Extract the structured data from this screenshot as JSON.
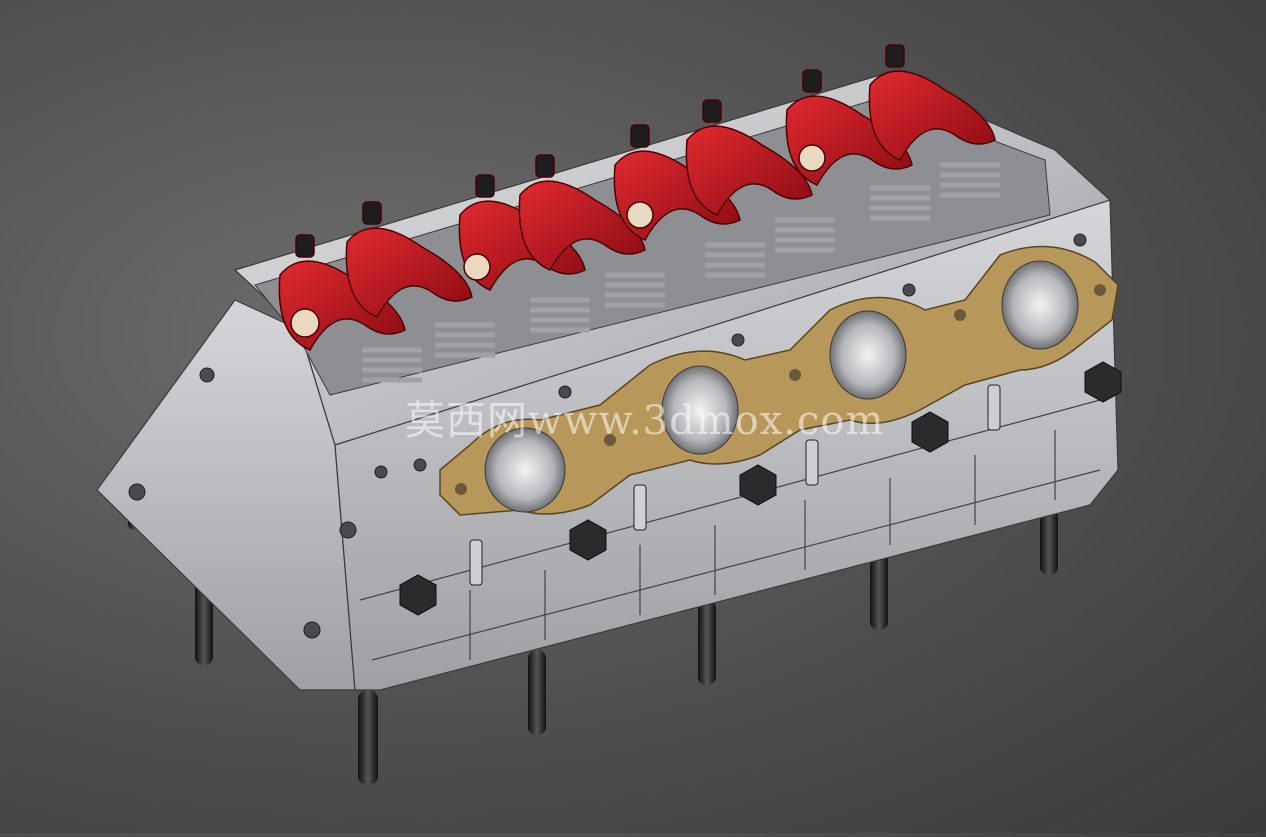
{
  "scene": {
    "subject": "cylinder-head-assembly",
    "colors": {
      "background": "#555555",
      "head_body": "#c9c9cc",
      "head_shadow": "#8f9095",
      "rocker_arm": "#c0121c",
      "gasket": "#b8975a",
      "spring": "#9a9a9e",
      "stud": "#2a2a2a"
    }
  },
  "watermark": {
    "text": "莫西网www.3dmox.com"
  }
}
